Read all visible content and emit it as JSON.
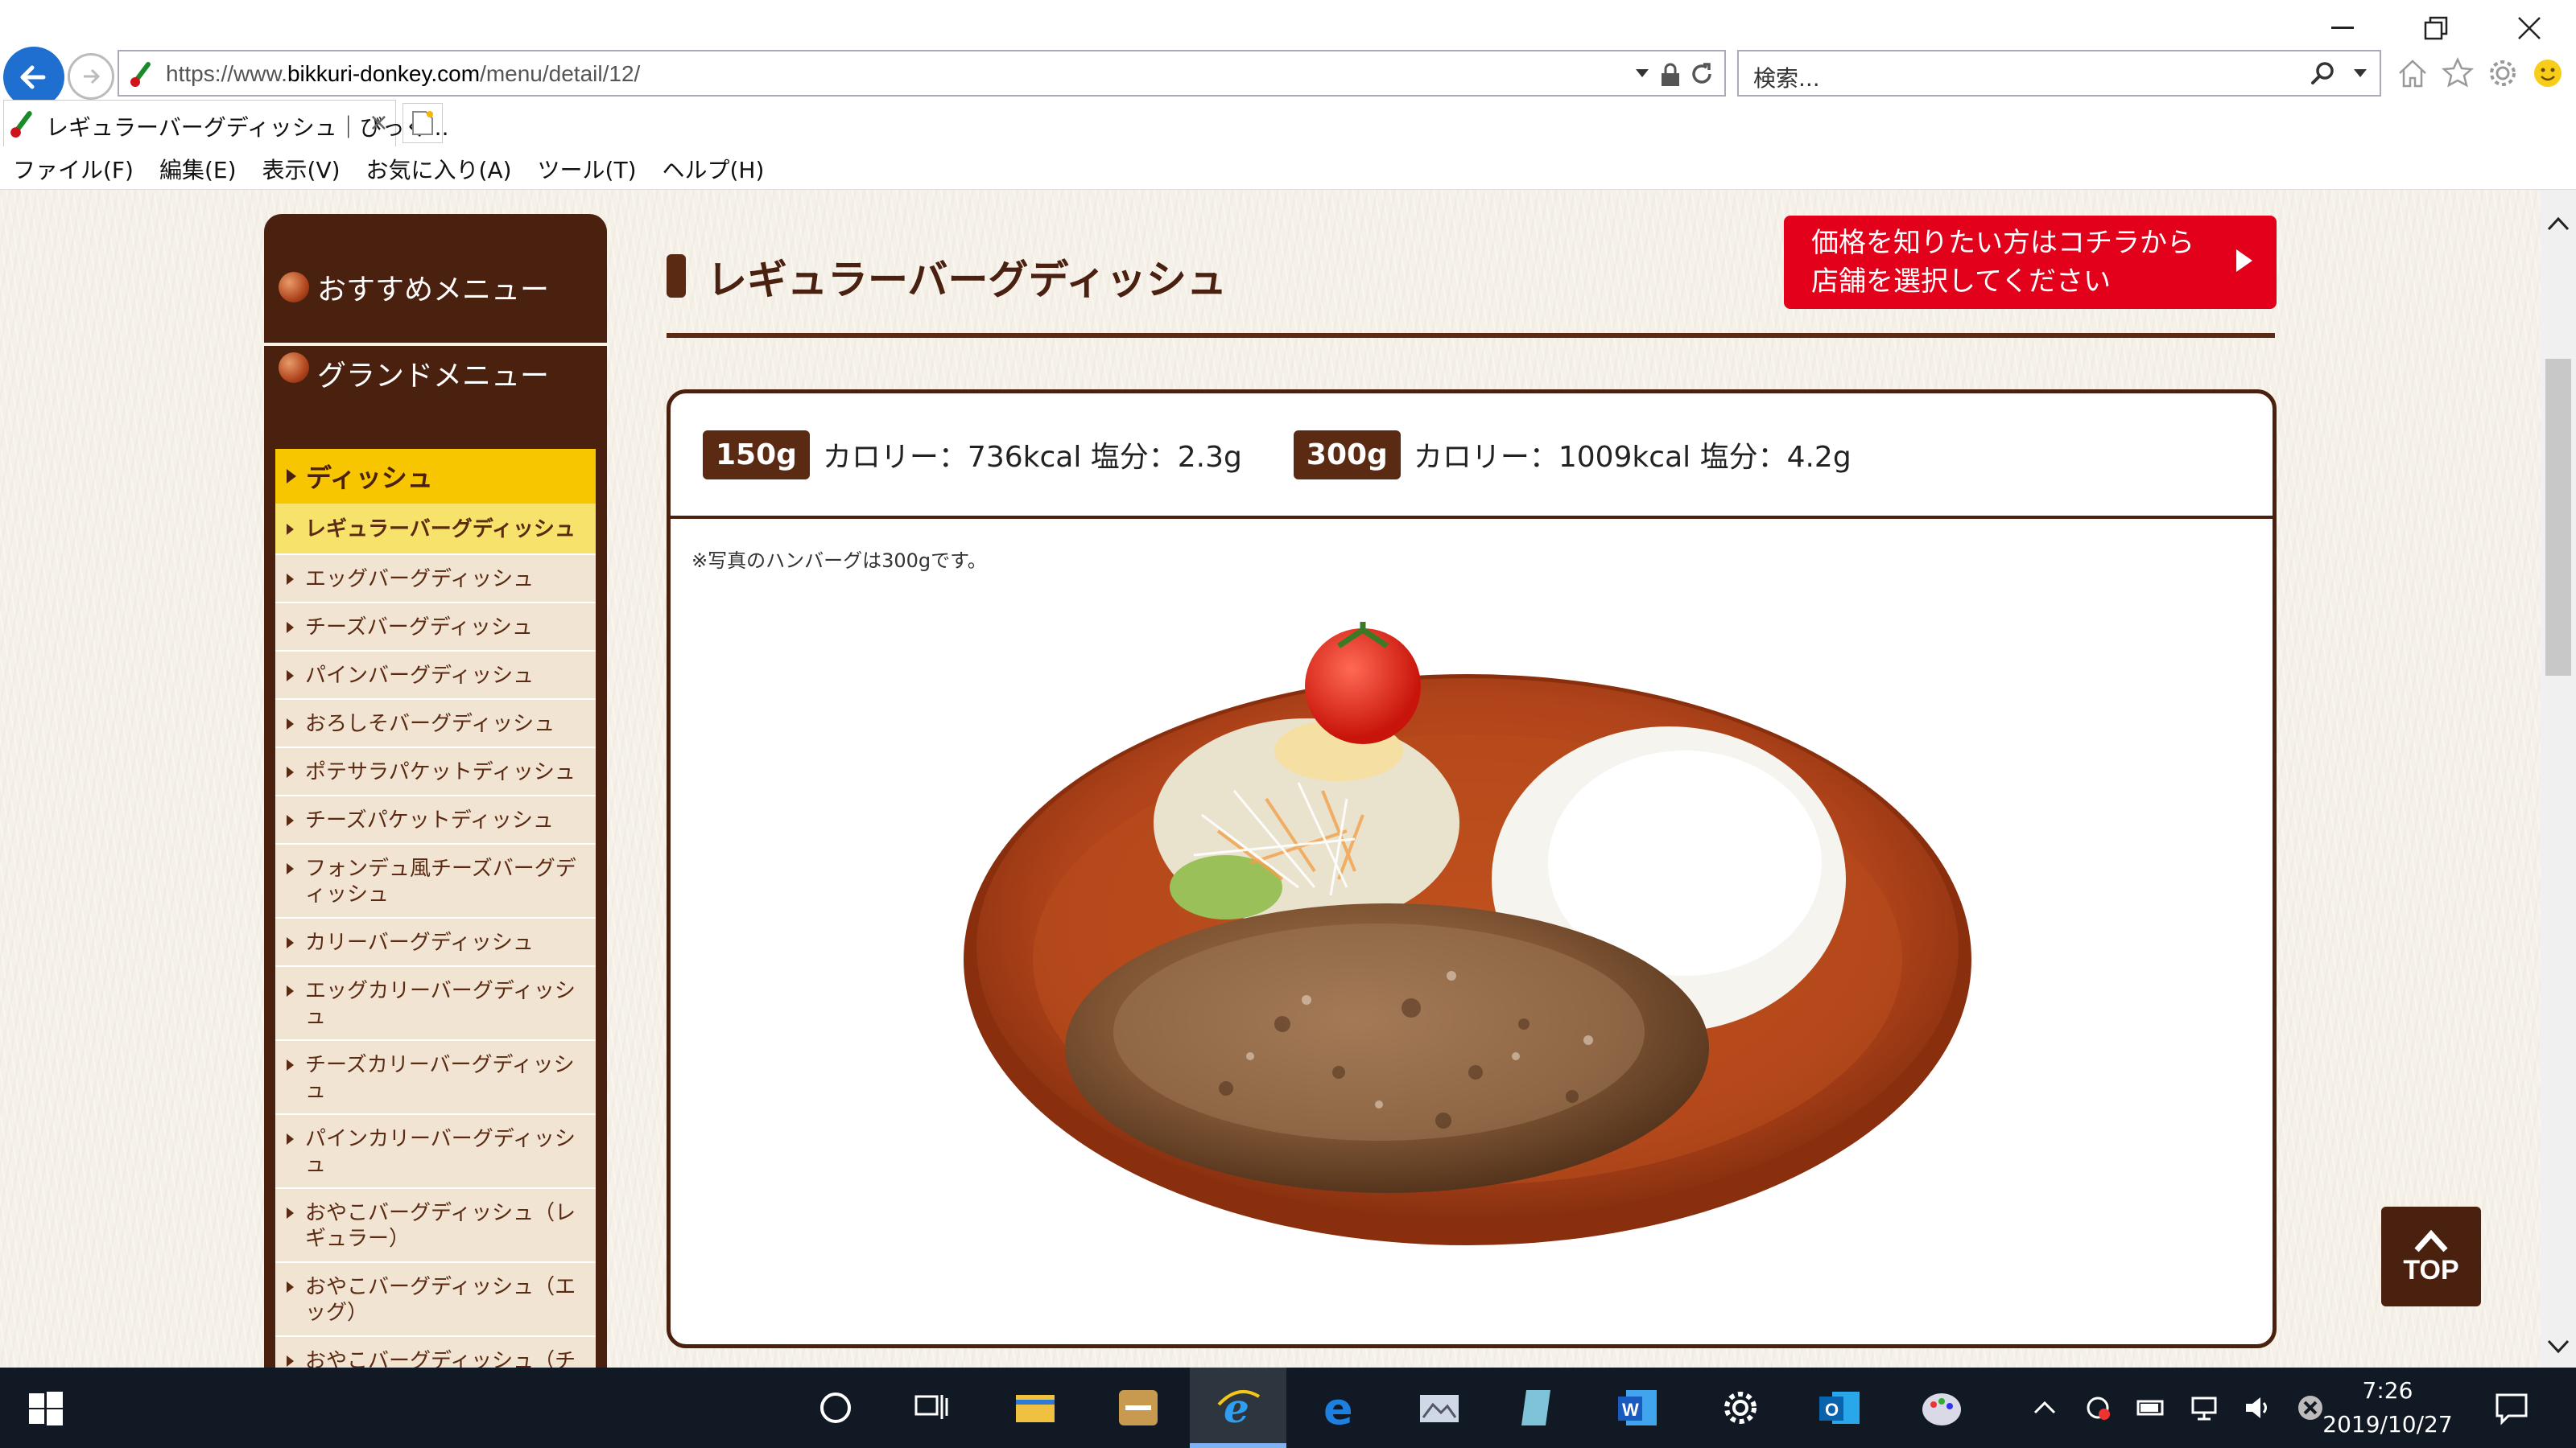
{
  "browser": {
    "url_prefix": "https://www.",
    "url_host": "bikkuri-donkey.com",
    "url_path": "/menu/detail/12/",
    "search_placeholder": "検索...",
    "tab_title": "レギュラーバーグディッシュ｜びっく...",
    "tab_close": "×",
    "menu": [
      "ファイル(F)",
      "編集(E)",
      "表示(V)",
      "お気に入り(A)",
      "ツール(T)",
      "ヘルプ(H)"
    ]
  },
  "sidebar": {
    "section1": "おすすめメニュー",
    "section2": "グランドメニュー",
    "category": "ディッシュ",
    "items": [
      "レギュラーバーグディッシュ",
      "エッグバーグディッシュ",
      "チーズバーグディッシュ",
      "パインバーグディッシュ",
      "おろしそバーグディッシュ",
      "ポテサラパケットディッシュ",
      "チーズパケットディッシュ",
      "フォンデュ風チーズバーグディッシュ",
      "カリーバーグディッシュ",
      "エッグカリーバーグディッシュ",
      "チーズカリーバーグディッシュ",
      "パインカリーバーグディッシュ",
      "おやこバーグディッシュ（レギュラー）",
      "おやこバーグディッシュ（エッグ）",
      "おやこバーグディッシュ（チーズ）"
    ]
  },
  "main": {
    "title": "レギュラーバーグディッシュ",
    "price_button_line1": "価格を知りたい方はコチラから",
    "price_button_line2": "店舗を選択してください",
    "nutrition": [
      {
        "size": "150g",
        "text": "カロリー：736kcal 塩分：2.3g"
      },
      {
        "size": "300g",
        "text": "カロリー：1009kcal 塩分：4.2g"
      }
    ],
    "photo_note": "※写真のハンバーグは300gです。",
    "top_button": "TOP"
  },
  "taskbar": {
    "time": "7:26",
    "date": "2019/10/27"
  },
  "colors": {
    "brown": "#4a200f",
    "accent_red": "#e2001a",
    "highlight_yellow": "#f7c600"
  }
}
